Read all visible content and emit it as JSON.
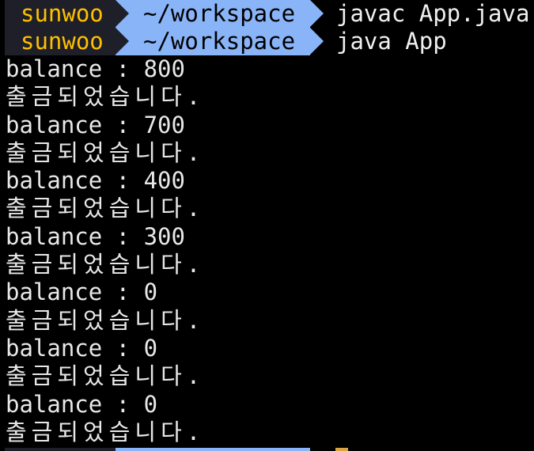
{
  "prompts": [
    {
      "user": "sunwoo",
      "path": "~/workspace",
      "command": "javac App.java"
    },
    {
      "user": "sunwoo",
      "path": "~/workspace",
      "command": "java App"
    }
  ],
  "output": [
    "balance : 800",
    "출금되었습니다.",
    "balance : 700",
    "출금되었습니다.",
    "balance : 400",
    "출금되었습니다.",
    "balance : 300",
    "출금되었습니다.",
    "balance : 0",
    "출금되었습니다.",
    "balance : 0",
    "출금되었습니다.",
    "balance : 0",
    "출금되었습니다."
  ],
  "colors": {
    "background": "#000000",
    "user_fg": "#ffc000",
    "user_bg": "#1e1f28",
    "path_bg": "#8ab4f8",
    "text": "#e8e8e8"
  }
}
